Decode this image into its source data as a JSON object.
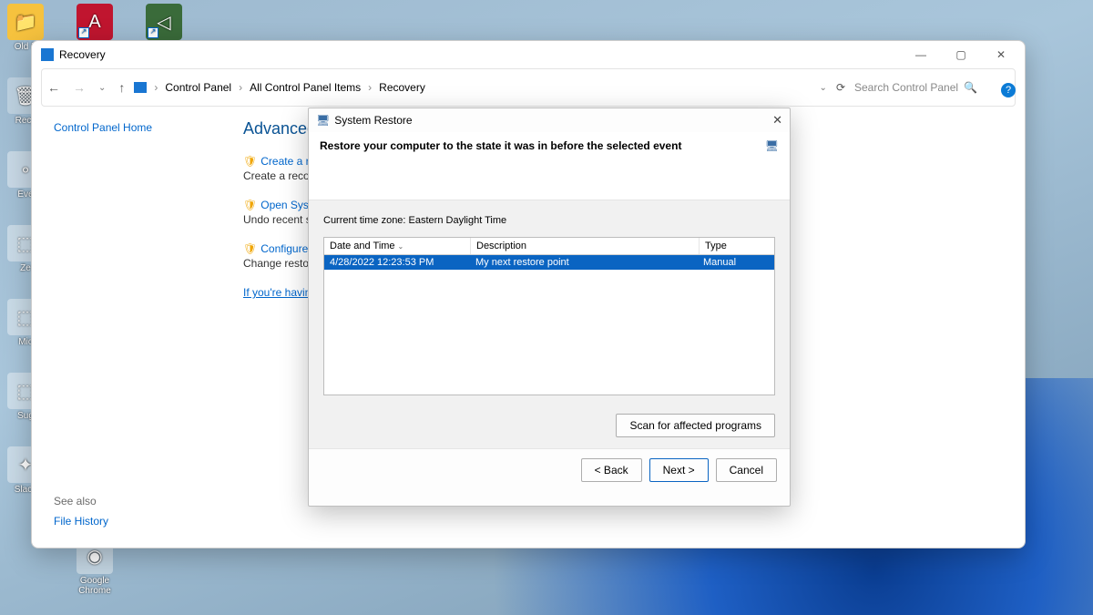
{
  "desktop": {
    "icons": [
      {
        "label": "Old F",
        "type": "folder"
      },
      {
        "label": "Recy",
        "type": "recycle"
      },
      {
        "label": "Eve",
        "type": "generic"
      },
      {
        "label": "Ze",
        "type": "generic"
      },
      {
        "label": "Mic",
        "type": "generic"
      },
      {
        "label": "Sug",
        "type": "generic"
      },
      {
        "label": "Slack",
        "type": "generic"
      }
    ],
    "top_icons": [
      {
        "label": "",
        "type": "adobe"
      },
      {
        "label": "",
        "type": "green"
      }
    ],
    "chrome_label": "Google Chrome"
  },
  "window": {
    "title": "Recovery",
    "breadcrumb": [
      "Control Panel",
      "All Control Panel Items",
      "Recovery"
    ],
    "search_placeholder": "Search Control Panel",
    "sidebar": {
      "home": "Control Panel Home",
      "see_also_heading": "See also",
      "see_also_link": "File History"
    },
    "main": {
      "heading": "Advanced reco",
      "items": [
        {
          "link": "Create a recove",
          "desc": "Create a recovery d"
        },
        {
          "link": "Open System Re",
          "desc": "Undo recent system"
        },
        {
          "link": "Configure Syste",
          "desc": "Change restore sett"
        }
      ],
      "trouble": "If you're having pro"
    }
  },
  "dialog": {
    "title": "System Restore",
    "header": "Restore your computer to the state it was in before the selected event",
    "timezone": "Current time zone: Eastern Daylight Time",
    "columns": {
      "c1": "Date and Time",
      "c2": "Description",
      "c3": "Type"
    },
    "row": {
      "datetime": "4/28/2022 12:23:53 PM",
      "desc": "My next restore point",
      "type": "Manual"
    },
    "scan_button": "Scan for affected programs",
    "buttons": {
      "back": "< Back",
      "next": "Next >",
      "cancel": "Cancel"
    }
  }
}
